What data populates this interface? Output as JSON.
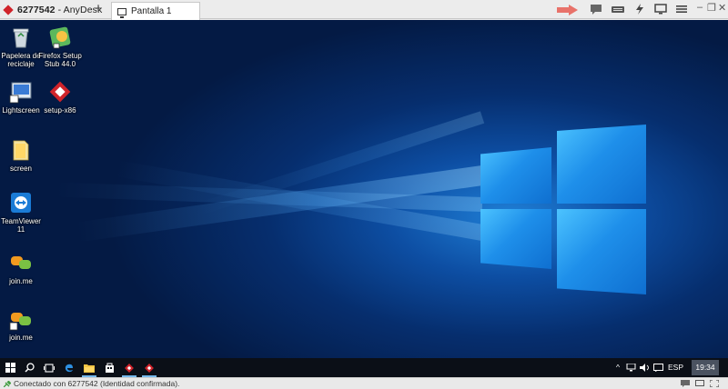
{
  "window": {
    "title_id": "6277542",
    "title_sep": " - ",
    "title_app": "AnyDesk",
    "new_tab": "+",
    "tab_label": "Pantalla 1",
    "min": "–",
    "restore": "❐",
    "close": "✕"
  },
  "toolbar": {
    "icons": [
      "chat-icon",
      "keyboard-icon",
      "actions-icon",
      "display-icon",
      "menu-icon"
    ],
    "pointer": "arrow-pointer-icon"
  },
  "desktop": {
    "icons": [
      {
        "label": "Papelera de reciclaje",
        "icon": "recycle-bin-icon"
      },
      {
        "label": "Firefox Setup Stub 44.0",
        "icon": "firefox-setup-icon"
      },
      {
        "label": "Lightscreen",
        "icon": "lightscreen-icon"
      },
      {
        "label": "setup-x86",
        "icon": "anydesk-setup-icon"
      },
      {
        "label": "screen",
        "icon": "folder-icon"
      },
      {
        "label": "TeamViewer 11",
        "icon": "teamviewer-icon"
      },
      {
        "label": "join.me",
        "icon": "joinme-icon"
      },
      {
        "label": "join.me",
        "icon": "joinme-icon"
      }
    ]
  },
  "taskbar": {
    "apps": [
      "start-icon",
      "search-icon",
      "task-view-icon",
      "edge-icon",
      "file-explorer-icon",
      "store-icon",
      "anydesk-taskbar-icon",
      "anydesk-taskbar-icon"
    ],
    "tray_chevron": "^",
    "language": "ESP",
    "time": "19:34"
  },
  "status": {
    "text": "Conectado con 6277542 (Identidad confirmada)."
  },
  "colors": {
    "accent_red": "#d0232a",
    "pointer": "#e8726a",
    "taskbar": "#0b0f17"
  }
}
